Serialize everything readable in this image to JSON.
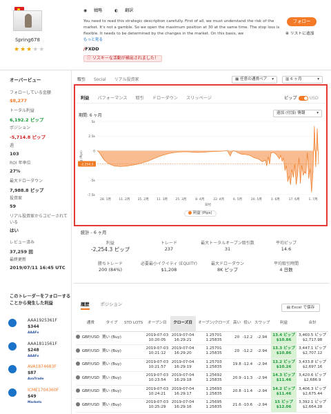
{
  "trader": {
    "name": "Spring678",
    "stars": 3,
    "strategy_label": "戦略",
    "translate_label": "翻訳",
    "description": "You need to read this strategic description carefully. First of all, we must understand the risk of the market. It's not a gamble. So we open the maximum position at 30 at the same time. The stop loss is flexible. It needs to be determined by the changes in the market. On this basis, we",
    "more_label": "もっと見る",
    "broker": "FXDD",
    "risk_warning": "リスキーな活動が検出されました！",
    "follow_label": "フォロー",
    "watchlist_label": "リストに追加"
  },
  "overview": {
    "title": "オーバービュー",
    "items": [
      {
        "label": "フォローしている金額",
        "value": "$8,277"
      },
      {
        "label": "トータル利益",
        "value": "6,192.2 ピップ"
      },
      {
        "label": "ポジション",
        "value": "-5,714.8 ピップ"
      },
      {
        "label": "週",
        "value": "103"
      },
      {
        "label": "ROI 年率位",
        "value": "27%"
      },
      {
        "label": "最大ドローダウン",
        "value": "7,988.8 ピップ"
      },
      {
        "label": "投資家",
        "value": "59"
      },
      {
        "label": "リアル投資家からコピーされている",
        "value": "はい"
      },
      {
        "label": "レビュー済み",
        "value": "37,259 回"
      },
      {
        "label": "最終更新",
        "value": "2019/07/11 16:45 UTC"
      }
    ]
  },
  "top_tabs": [
    "取引",
    "Social",
    "リアル投資家"
  ],
  "pair_dropdown": "任意の通貨ペア",
  "period_dropdown": "6 ヶ月",
  "chart_tabs": [
    "利益",
    "パフォーマンス",
    "取引",
    "ドローダウン",
    "スリッページ"
  ],
  "pip_toggle": {
    "left": "ピップ",
    "right": "USD"
  },
  "period_label": "期間: 6 ヶ月",
  "add_info_label": "追加 (付加) 情報",
  "chart_data": {
    "type": "area",
    "title": "",
    "xlabel": "日付",
    "ylabel": "利益 (Pips)",
    "x_ticks": [
      "28. 1月",
      "11. 2月",
      "25. 2月",
      "11. 3月",
      "25. 3月",
      "8. 4月",
      "22. 4月",
      "6. 5月",
      "20. 5月",
      "3. 6月",
      "17. 6月",
      "1. 7月"
    ],
    "y_ticks": [
      "5k",
      "2.5k",
      "0",
      "-2.5k",
      "-5k",
      "-7.5k"
    ],
    "ylim": [
      -7500,
      5000
    ],
    "current_label": "-2,254.3",
    "legend": "利益 (Pips)",
    "series": [
      {
        "name": "利益 (Pips)",
        "points": [
          [
            0,
            0
          ],
          [
            1,
            -150
          ],
          [
            3,
            -900
          ],
          [
            5,
            -1600
          ],
          [
            8,
            -2200
          ],
          [
            12,
            -2600
          ],
          [
            16,
            -2700
          ],
          [
            20,
            -2650
          ],
          [
            24,
            -2500
          ],
          [
            28,
            -2350
          ],
          [
            32,
            -2100
          ],
          [
            36,
            -1800
          ],
          [
            40,
            -1400
          ],
          [
            44,
            -1000
          ],
          [
            48,
            -700
          ],
          [
            52,
            -450
          ],
          [
            56,
            -280
          ],
          [
            60,
            -200
          ],
          [
            64,
            -180
          ],
          [
            68,
            -250
          ],
          [
            72,
            -300
          ],
          [
            76,
            -250
          ],
          [
            80,
            -180
          ],
          [
            84,
            -150
          ],
          [
            88,
            -100
          ],
          [
            91,
            -50
          ],
          [
            93,
            0
          ],
          [
            94,
            -500
          ],
          [
            95,
            -900
          ],
          [
            96,
            -300
          ],
          [
            97,
            0
          ],
          [
            99,
            -150
          ],
          [
            101,
            -400
          ],
          [
            103,
            -600
          ],
          [
            106,
            -650
          ],
          [
            109,
            -800
          ],
          [
            112,
            -1200
          ],
          [
            115,
            -1400
          ],
          [
            118,
            -1900
          ],
          [
            120,
            -1600
          ],
          [
            121,
            -2600
          ],
          [
            122,
            -1000
          ],
          [
            123,
            -2300
          ],
          [
            124,
            -400
          ],
          [
            126,
            -300
          ],
          [
            128,
            -700
          ],
          [
            130,
            -1400
          ],
          [
            131,
            -800
          ],
          [
            132,
            -1800
          ],
          [
            133,
            -1200
          ],
          [
            134,
            -3400
          ],
          [
            135,
            -2600
          ],
          [
            136,
            -5300
          ],
          [
            137,
            -4300
          ],
          [
            138,
            -5800
          ],
          [
            139,
            -3200
          ],
          [
            140,
            -4600
          ],
          [
            141,
            -2300
          ],
          [
            142,
            -5800
          ],
          [
            143,
            -4200
          ],
          [
            144,
            -1200
          ],
          [
            145,
            -5600
          ],
          [
            146,
            -2500
          ],
          [
            147,
            -4200
          ],
          [
            148,
            -3600
          ],
          [
            149,
            -3900
          ],
          [
            150,
            -300
          ],
          [
            151,
            -4800
          ],
          [
            152,
            -3100
          ],
          [
            153,
            -7100
          ],
          [
            154,
            -3500
          ],
          [
            155,
            4200
          ],
          [
            156,
            -2800
          ],
          [
            157,
            3800
          ],
          [
            158,
            -2254
          ]
        ]
      }
    ]
  },
  "stats": {
    "title": "統計 - 6 ヶ月",
    "items": [
      {
        "label": "利益",
        "value": "-2,254.3 ピップ"
      },
      {
        "label": "トレード",
        "value": "237"
      },
      {
        "label": "最大トータルオープン取引数",
        "value": "31"
      },
      {
        "label": "平均ピップ",
        "value": "14.6"
      },
      {
        "label": "勝ちトレード",
        "value": "200 (84%)"
      },
      {
        "label": "必要最小イクイティ (EQUITY)",
        "value": "$1,208"
      },
      {
        "label": "最大ドローダウン",
        "value": "8K ピップ"
      },
      {
        "label": "平均取引時間",
        "value": "4 日数"
      }
    ]
  },
  "followers": {
    "title": "このトレーダーをフォローすることから発生した利益",
    "items": [
      {
        "name": "AAA1925361F",
        "value": "$344",
        "broker": "AAAFx"
      },
      {
        "name": "AAA1811561F",
        "value": "$248",
        "broker": "AAAFx"
      },
      {
        "name": "AVA1874683F",
        "value": "$87",
        "broker": "AvaTrade"
      },
      {
        "name": "ICME1704360F",
        "value": "$49",
        "broker": "Markets"
      }
    ]
  },
  "history": {
    "tabs": [
      "履歴",
      "ポジション"
    ],
    "excel_label": "Excel で保存",
    "columns": [
      "",
      "通貨",
      "タイプ",
      "STD LOTS",
      "オープン日",
      "クローズ日",
      "オープン/クローズ",
      "高い",
      "低い",
      "スワップ",
      "利益",
      "合計"
    ],
    "rows": [
      {
        "pair": "GBP/USD",
        "type": "買い (Buy)",
        "open": [
          "2019-07-03",
          "10:20:05"
        ],
        "close": [
          "2019-07-04",
          "16:29:21"
        ],
        "oc": [
          "1.25701",
          "1.25835"
        ],
        "high": "20",
        "low": "-12.2",
        "swap": "-2.94",
        "profit": [
          "13.4 ピップ",
          "$10.86"
        ],
        "total": [
          "3,460.5 ピップ",
          "$2,717.98"
        ]
      },
      {
        "pair": "GBP/USD",
        "type": "買い (Buy)",
        "open": [
          "2019-07-03",
          "10:21:12"
        ],
        "close": [
          "2019-07-04",
          "16:29:20"
        ],
        "oc": [
          "1.25701",
          "1.25835"
        ],
        "high": "20",
        "low": "-12.2",
        "swap": "-2.94",
        "profit": [
          "13.3 ピップ",
          "$10.86"
        ],
        "total": [
          "3,447.1 ピップ",
          "$2,707.12"
        ]
      },
      {
        "pair": "GBP/USD",
        "type": "買い (Buy)",
        "open": [
          "2019-07-03",
          "10:21:57"
        ],
        "close": [
          "2019-07-04",
          "16:29:19"
        ],
        "oc": [
          "1.25703",
          "1.25835"
        ],
        "high": "19.8",
        "low": "-12.4",
        "swap": "-2.94",
        "profit": [
          "13.2 ピップ",
          "$10.26"
        ],
        "total": [
          "3,433.8 ピップ",
          "$2,697.16"
        ]
      },
      {
        "pair": "GBP/USD",
        "type": "買い (Buy)",
        "open": [
          "2019-07-03",
          "10:23:54"
        ],
        "close": [
          "2019-07-04",
          "16:29:18"
        ],
        "oc": [
          "1.25692",
          "1.25835"
        ],
        "high": "20.9",
        "low": "-11.3",
        "swap": "-2.94",
        "profit": [
          "14.3 ピップ",
          "$11.46"
        ],
        "total": [
          "3,420.6 ピップ",
          "$2,686.9"
        ]
      },
      {
        "pair": "GBP/USD",
        "type": "買い (Buy)",
        "open": [
          "2019-07-03",
          "10:24:21"
        ],
        "close": [
          "2019-07-04",
          "16:29:17"
        ],
        "oc": [
          "1.25693",
          "1.25835"
        ],
        "high": "20.8",
        "low": "-11.4",
        "swap": "-2.94",
        "profit": [
          "14.2 ピップ",
          "$11.46"
        ],
        "total": [
          "3,406.3 ピップ",
          "$2,675.44"
        ]
      },
      {
        "pair": "GBP/USD",
        "type": "買い (Buy)",
        "open": [
          "2019-07-03",
          "10:25:29"
        ],
        "close": [
          "2019-07-04",
          "16:29:16"
        ],
        "oc": [
          "1.25695",
          "1.25835"
        ],
        "high": "21.6",
        "low": "-10.6",
        "swap": "-2.94",
        "profit": [
          "15 ピップ",
          "$12.06"
        ],
        "total": [
          "3,392.1 ピップ",
          "$2,664.28"
        ]
      }
    ]
  }
}
